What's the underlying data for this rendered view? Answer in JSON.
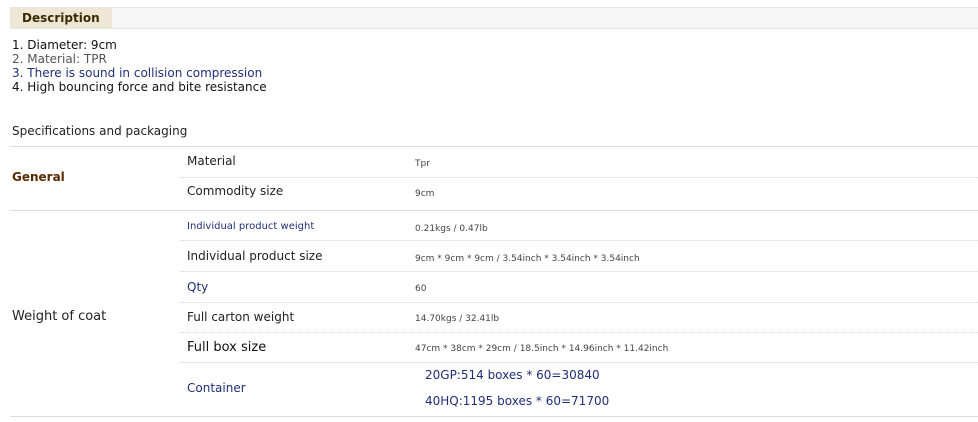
{
  "description": {
    "tab_label": "Description",
    "items": [
      "1. Diameter: 9cm",
      "2. Material: TPR",
      "3. There is sound in collision compression",
      "4. High bouncing force and bite resistance"
    ]
  },
  "specs": {
    "title": "Specifications and packaging",
    "general": {
      "label": "General",
      "rows": [
        {
          "name": "Material",
          "value": "Tpr"
        },
        {
          "name": "Commodity size",
          "value": "9cm"
        }
      ]
    },
    "weight": {
      "label": "Weight of coat",
      "rows": [
        {
          "name": "Individual product weight",
          "value": "0.21kgs / 0.47lb"
        },
        {
          "name": "Individual product size",
          "value": "9cm * 9cm * 9cm / 3.54inch * 3.54inch * 3.54inch"
        },
        {
          "name": "Qty",
          "value": "60"
        },
        {
          "name": "Full carton weight",
          "value": "14.70kgs / 32.41lb"
        },
        {
          "name": "Full box size",
          "value": "47cm * 38cm * 29cm / 18.5inch * 14.96inch * 11.42inch"
        }
      ],
      "container": {
        "name": "Container",
        "values": [
          "20GP:514 boxes * 60=30840",
          "40HQ:1195 boxes * 60=71700"
        ]
      }
    }
  }
}
